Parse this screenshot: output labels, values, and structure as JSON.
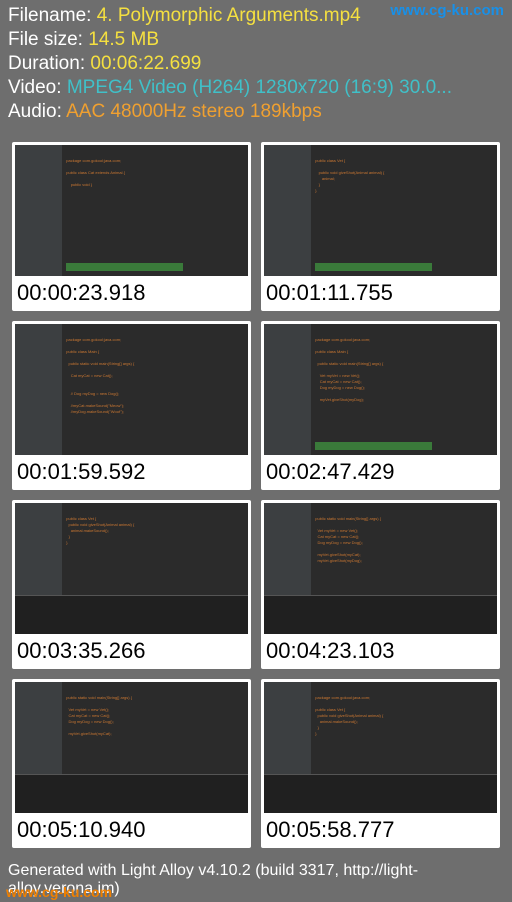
{
  "meta": {
    "filename_label": "Filename:",
    "filename": "4. Polymorphic Arguments.mp4",
    "filesize_label": "File size:",
    "filesize": "14.5 MB",
    "duration_label": "Duration:",
    "duration": "00:06:22.699",
    "video_label": "Video:",
    "video": "MPEG4 Video (H264) 1280x720 (16:9) 30.0...",
    "audio_label": "Audio:",
    "audio": "AAC 48000Hz stereo 189kbps"
  },
  "watermark_top": "www.cg-ku.com",
  "watermark_bottom": "www.cg-ku.com",
  "thumbnails": [
    {
      "time": "00:00:23.918",
      "green_bar": true,
      "console": false
    },
    {
      "time": "00:01:11.755",
      "green_bar": true,
      "console": false
    },
    {
      "time": "00:01:59.592",
      "green_bar": false,
      "console": false
    },
    {
      "time": "00:02:47.429",
      "green_bar": true,
      "console": false
    },
    {
      "time": "00:03:35.266",
      "green_bar": false,
      "console": true
    },
    {
      "time": "00:04:23.103",
      "green_bar": false,
      "console": true
    },
    {
      "time": "00:05:10.940",
      "green_bar": false,
      "console": true
    },
    {
      "time": "00:05:58.777",
      "green_bar": false,
      "console": true
    }
  ],
  "footer": "Generated with Light Alloy v4.10.2 (build 3317, http://light-alloy.verona.im)"
}
